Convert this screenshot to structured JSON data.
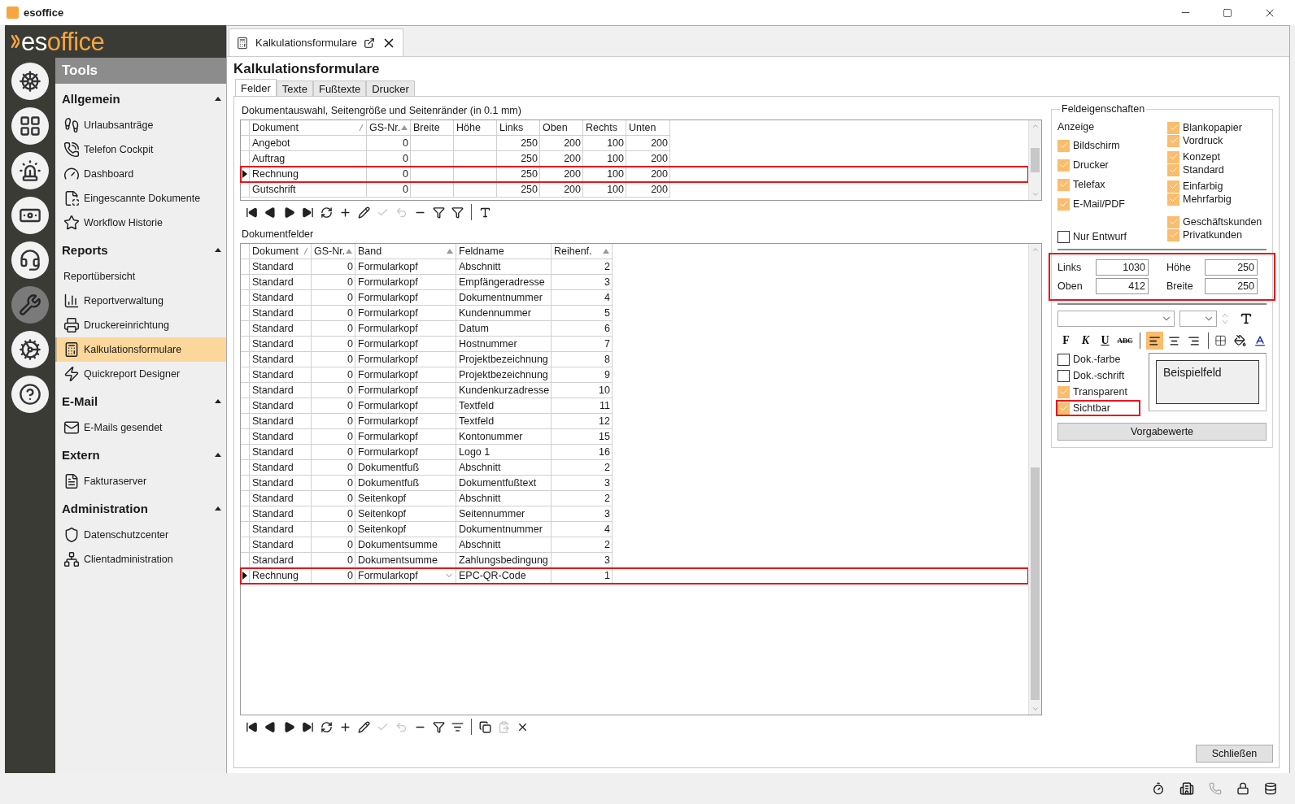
{
  "window": {
    "title": "esoffice"
  },
  "logo": {
    "lead": "es",
    "rest": "office"
  },
  "rail": [
    {
      "selected": false
    },
    {
      "selected": false
    },
    {
      "selected": false
    },
    {
      "selected": false
    },
    {
      "selected": false
    },
    {
      "selected": true
    },
    {
      "selected": false
    },
    {
      "selected": false
    }
  ],
  "sidebar": {
    "title": "Tools",
    "sections": [
      {
        "title": "Allgemein",
        "expanded": true,
        "items": [
          {
            "label": "Urlaubsanträge",
            "selected": false
          },
          {
            "label": "Telefon Cockpit",
            "selected": false
          },
          {
            "label": "Dashboard",
            "selected": false
          },
          {
            "label": "Eingescannte Dokumente",
            "selected": false
          },
          {
            "label": "Workflow Historie",
            "selected": false
          }
        ]
      },
      {
        "title": "Reports",
        "expanded": true,
        "items": [
          {
            "label": "Reportübersicht",
            "selected": false
          },
          {
            "label": "Reportverwaltung",
            "selected": false
          },
          {
            "label": "Druckereinrichtung",
            "selected": false
          },
          {
            "label": "Kalkulationsformulare",
            "selected": true
          },
          {
            "label": "Quickreport Designer",
            "selected": false
          }
        ]
      },
      {
        "title": "E-Mail",
        "expanded": true,
        "items": [
          {
            "label": "E-Mails gesendet",
            "selected": false
          }
        ]
      },
      {
        "title": "Extern",
        "expanded": true,
        "items": [
          {
            "label": "Fakturaserver",
            "selected": false
          }
        ]
      },
      {
        "title": "Administration",
        "expanded": true,
        "items": [
          {
            "label": "Datenschutzcenter",
            "selected": false
          },
          {
            "label": "Clientadministration",
            "selected": false
          }
        ]
      }
    ]
  },
  "document_tab": {
    "title": "Kalkulationsformulare"
  },
  "page_title": "Kalkulationsformulare",
  "tabs": [
    {
      "label": "Felder",
      "selected": true
    },
    {
      "label": "Texte",
      "selected": false
    },
    {
      "label": "Fußtexte",
      "selected": false
    },
    {
      "label": "Drucker",
      "selected": false
    }
  ],
  "documents": {
    "caption": "Dokumentauswahl, Seitengröße und Seitenränder (in 0.1 mm)",
    "columns": [
      {
        "label": "Dokument",
        "sorted": false,
        "grip": true
      },
      {
        "label": "GS-Nr.",
        "sorted": true
      },
      {
        "label": "Breite",
        "sorted": false
      },
      {
        "label": "Höhe",
        "sorted": false
      },
      {
        "label": "Links",
        "sorted": false
      },
      {
        "label": "Oben",
        "sorted": false
      },
      {
        "label": "Rechts",
        "sorted": false
      },
      {
        "label": "Unten",
        "sorted": false
      }
    ],
    "rows": [
      {
        "cells": [
          "Angebot",
          "0",
          null,
          null,
          "250",
          "200",
          "100",
          "200"
        ],
        "selected": false,
        "highlighted": false
      },
      {
        "cells": [
          "Auftrag",
          "0",
          null,
          null,
          "250",
          "200",
          "100",
          "200"
        ],
        "selected": false,
        "highlighted": false
      },
      {
        "cells": [
          "Rechnung",
          "0",
          null,
          null,
          "250",
          "200",
          "100",
          "200"
        ],
        "selected": true,
        "highlighted": true
      },
      {
        "cells": [
          "Gutschrift",
          "0",
          null,
          null,
          "250",
          "200",
          "100",
          "200"
        ],
        "selected": false,
        "highlighted": false
      }
    ],
    "toolbar": [
      {
        "kind": "first",
        "disabled": false
      },
      {
        "kind": "prev",
        "disabled": false
      },
      {
        "kind": "next",
        "disabled": false
      },
      {
        "kind": "last",
        "disabled": false
      },
      {
        "kind": "refresh",
        "disabled": false
      },
      {
        "kind": "add",
        "disabled": false
      },
      {
        "kind": "edit",
        "disabled": false
      },
      {
        "kind": "post",
        "disabled": true
      },
      {
        "kind": "cancel",
        "disabled": true
      },
      {
        "kind": "delete",
        "disabled": false
      },
      {
        "kind": "filter",
        "disabled": false
      },
      {
        "kind": "filter2",
        "disabled": false
      },
      {
        "kind": "sep"
      },
      {
        "kind": "font",
        "disabled": false
      }
    ]
  },
  "fields": {
    "caption": "Dokumentfelder",
    "columns": [
      {
        "label": "Dokument",
        "sorted": false,
        "grip": true
      },
      {
        "label": "GS-Nr.",
        "sorted": true
      },
      {
        "label": "Band",
        "sorted": true
      },
      {
        "label": "Feldname",
        "sorted": false
      },
      {
        "label": "Reihenf.",
        "sorted": true
      }
    ],
    "rows": [
      {
        "cells": [
          "Standard",
          "0",
          "Formularkopf",
          "Abschnitt",
          "2"
        ],
        "selected": false,
        "highlighted": false
      },
      {
        "cells": [
          "Standard",
          "0",
          "Formularkopf",
          "Empfängeradresse",
          "3"
        ],
        "selected": false,
        "highlighted": false
      },
      {
        "cells": [
          "Standard",
          "0",
          "Formularkopf",
          "Dokumentnummer",
          "4"
        ],
        "selected": false,
        "highlighted": false
      },
      {
        "cells": [
          "Standard",
          "0",
          "Formularkopf",
          "Kundennummer",
          "5"
        ],
        "selected": false,
        "highlighted": false
      },
      {
        "cells": [
          "Standard",
          "0",
          "Formularkopf",
          "Datum",
          "6"
        ],
        "selected": false,
        "highlighted": false
      },
      {
        "cells": [
          "Standard",
          "0",
          "Formularkopf",
          "Hostnummer",
          "7"
        ],
        "selected": false,
        "highlighted": false
      },
      {
        "cells": [
          "Standard",
          "0",
          "Formularkopf",
          "Projektbezeichnung",
          "8"
        ],
        "selected": false,
        "highlighted": false
      },
      {
        "cells": [
          "Standard",
          "0",
          "Formularkopf",
          "Projektbezeichnung",
          "9"
        ],
        "selected": false,
        "highlighted": false
      },
      {
        "cells": [
          "Standard",
          "0",
          "Formularkopf",
          "Kundenkurzadresse",
          "10"
        ],
        "selected": false,
        "highlighted": false
      },
      {
        "cells": [
          "Standard",
          "0",
          "Formularkopf",
          "Textfeld",
          "11"
        ],
        "selected": false,
        "highlighted": false
      },
      {
        "cells": [
          "Standard",
          "0",
          "Formularkopf",
          "Textfeld",
          "12"
        ],
        "selected": false,
        "highlighted": false
      },
      {
        "cells": [
          "Standard",
          "0",
          "Formularkopf",
          "Kontonummer",
          "15"
        ],
        "selected": false,
        "highlighted": false
      },
      {
        "cells": [
          "Standard",
          "0",
          "Formularkopf",
          "Logo 1",
          "16"
        ],
        "selected": false,
        "highlighted": false
      },
      {
        "cells": [
          "Standard",
          "0",
          "Dokumentfuß",
          "Abschnitt",
          "2"
        ],
        "selected": false,
        "highlighted": false
      },
      {
        "cells": [
          "Standard",
          "0",
          "Dokumentfuß",
          "Dokumentfußtext",
          "3"
        ],
        "selected": false,
        "highlighted": false
      },
      {
        "cells": [
          "Standard",
          "0",
          "Seitenkopf",
          "Abschnitt",
          "2"
        ],
        "selected": false,
        "highlighted": false
      },
      {
        "cells": [
          "Standard",
          "0",
          "Seitenkopf",
          "Seitennummer",
          "3"
        ],
        "selected": false,
        "highlighted": false
      },
      {
        "cells": [
          "Standard",
          "0",
          "Seitenkopf",
          "Dokumentnummer",
          "4"
        ],
        "selected": false,
        "highlighted": false
      },
      {
        "cells": [
          "Standard",
          "0",
          "Dokumentsumme",
          "Abschnitt",
          "2"
        ],
        "selected": false,
        "highlighted": false
      },
      {
        "cells": [
          "Standard",
          "0",
          "Dokumentsumme",
          "Zahlungsbedingung",
          "3"
        ],
        "selected": false,
        "highlighted": false
      },
      {
        "cells": [
          "Rechnung",
          "0",
          "Formularkopf",
          "EPC-QR-Code",
          "1"
        ],
        "selected": true,
        "highlighted": true
      }
    ],
    "toolbar": [
      {
        "kind": "first",
        "disabled": false
      },
      {
        "kind": "prev",
        "disabled": false
      },
      {
        "kind": "next",
        "disabled": false
      },
      {
        "kind": "last",
        "disabled": false
      },
      {
        "kind": "refresh",
        "disabled": false
      },
      {
        "kind": "add",
        "disabled": false
      },
      {
        "kind": "edit",
        "disabled": false
      },
      {
        "kind": "post",
        "disabled": true
      },
      {
        "kind": "cancel",
        "disabled": true
      },
      {
        "kind": "delete",
        "disabled": false
      },
      {
        "kind": "filter",
        "disabled": false
      },
      {
        "kind": "filterlist",
        "disabled": false
      },
      {
        "kind": "sep"
      },
      {
        "kind": "copy",
        "disabled": false
      },
      {
        "kind": "paste",
        "disabled": true
      },
      {
        "kind": "remove",
        "disabled": false
      }
    ]
  },
  "properties": {
    "title": "Feldeigenschaften",
    "display_label": "Anzeige",
    "display_options": [
      {
        "label": "Bildschirm",
        "checked": true
      },
      {
        "label": "Drucker",
        "checked": true
      },
      {
        "label": "Telefax",
        "checked": true
      },
      {
        "label": "E-Mail/PDF",
        "checked": true
      }
    ],
    "draft_option": {
      "label": "Nur Entwurf",
      "checked": false
    },
    "variant_groups": [
      [
        {
          "label": "Blankopapier",
          "checked": true
        },
        {
          "label": "Vordruck",
          "checked": true
        }
      ],
      [
        {
          "label": "Konzept",
          "checked": true
        },
        {
          "label": "Standard",
          "checked": true
        }
      ],
      [
        {
          "label": "Einfarbig",
          "checked": true
        },
        {
          "label": "Mehrfarbig",
          "checked": true
        }
      ],
      [
        {
          "label": "Geschäftskunden",
          "checked": true
        },
        {
          "label": "Privatkunden",
          "checked": true
        }
      ]
    ],
    "position": {
      "highlighted": true,
      "fields": [
        {
          "label": "Links",
          "value": "1030"
        },
        {
          "label": "Höhe",
          "value": "250"
        },
        {
          "label": "Oben",
          "value": "412"
        },
        {
          "label": "Breite",
          "value": "250"
        }
      ]
    },
    "format_buttons": [
      {
        "label": "F",
        "selected": false
      },
      {
        "label": "K",
        "selected": false
      },
      {
        "label": "U",
        "selected": false
      },
      {
        "label": "ABC",
        "selected": false
      }
    ],
    "align_buttons": [
      {
        "kind": "left",
        "selected": true
      },
      {
        "kind": "center",
        "selected": false
      },
      {
        "kind": "right",
        "selected": false
      }
    ],
    "style_options": [
      {
        "label": "Dok.-farbe",
        "checked": false,
        "highlighted": false
      },
      {
        "label": "Dok.-schrift",
        "checked": false,
        "highlighted": false
      },
      {
        "label": "Transparent",
        "checked": true,
        "highlighted": false
      },
      {
        "label": "Sichtbar",
        "checked": true,
        "highlighted": true
      }
    ],
    "preview": "Beispielfeld",
    "defaults_button": "Vorgabewerte"
  },
  "close_button": "Schließen"
}
